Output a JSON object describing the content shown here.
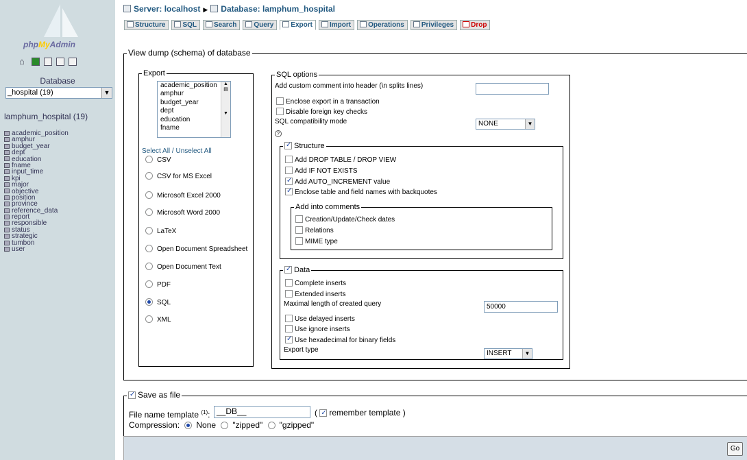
{
  "sidebar": {
    "logo_prefix": "php",
    "logo_my": "My",
    "logo_suffix": "Admin",
    "database_label": "Database",
    "database_select": "_hospital (19)",
    "db_link": "lamphum_hospital (19)",
    "tables": [
      "academic_position",
      "amphur",
      "budget_year",
      "dept",
      "education",
      "fname",
      "input_time",
      "kpi",
      "major",
      "objective",
      "position",
      "province",
      "reference_data",
      "report",
      "responsible",
      "status",
      "strategic",
      "tumbon",
      "user"
    ]
  },
  "header": {
    "server": "Server: localhost",
    "database": "Database: lamphum_hospital",
    "tabs": [
      "Structure",
      "SQL",
      "Search",
      "Query",
      "Export",
      "Import",
      "Operations",
      "Privileges",
      "Drop"
    ]
  },
  "main": {
    "legend": "View dump (schema) of database",
    "export": {
      "legend": "Export",
      "list_items": [
        "academic_position",
        "amphur",
        "budget_year",
        "dept",
        "education",
        "fname"
      ],
      "select_all": "Select All / Unselect All",
      "formats": [
        "CSV",
        "CSV for MS Excel",
        "Microsoft Excel 2000",
        "Microsoft Word 2000",
        "LaTeX",
        "Open Document Spreadsheet",
        "Open Document Text",
        "PDF",
        "SQL",
        "XML"
      ],
      "selected_format": "SQL"
    },
    "sql_options": {
      "legend": "SQL options",
      "header_comment_label": "Add custom comment into header (\\n splits lines)",
      "header_comment_value": "",
      "enclose_transaction": "Enclose export in a transaction",
      "disable_fk": "Disable foreign key checks",
      "compat_label": "SQL compatibility mode",
      "compat_value": "NONE",
      "structure": {
        "legend": "Structure",
        "drop_table": "Add DROP TABLE / DROP VIEW",
        "if_not_exists": "Add IF NOT EXISTS",
        "auto_increment": "Add AUTO_INCREMENT value",
        "backquotes": "Enclose table and field names with backquotes",
        "comments": {
          "legend": "Add into comments",
          "dates": "Creation/Update/Check dates",
          "relations": "Relations",
          "mime": "MIME type"
        }
      },
      "data": {
        "legend": "Data",
        "complete_inserts": "Complete inserts",
        "extended_inserts": "Extended inserts",
        "max_length_label": "Maximal length of created query",
        "max_length_value": "50000",
        "delayed_inserts": "Use delayed inserts",
        "ignore_inserts": "Use ignore inserts",
        "hex_binary": "Use hexadecimal for binary fields",
        "export_type_label": "Export type",
        "export_type_value": "INSERT"
      }
    }
  },
  "save": {
    "legend": "Save as file",
    "filename_label": "File name template",
    "filename_sup": "(1)",
    "filename_colon": ":",
    "filename_value": "__DB__",
    "paren_open": "(",
    "remember": "remember template )",
    "compression_label": "Compression:",
    "compression_options": [
      "None",
      "\"zipped\"",
      "\"gzipped\""
    ],
    "compression_selected": "None"
  },
  "go_label": "Go"
}
